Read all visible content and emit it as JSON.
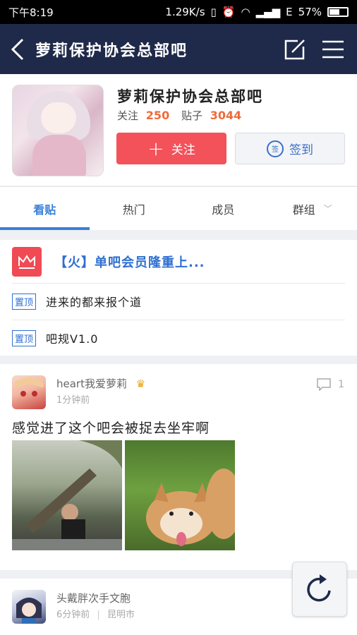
{
  "status_bar": {
    "time": "下午8:19",
    "speed": "1.29K/s",
    "network": "E",
    "battery": "57%"
  },
  "nav": {
    "title": "萝莉保护协会总部吧"
  },
  "forum": {
    "name": "萝莉保护协会总部吧",
    "follow_label": "关注",
    "follow_count": "250",
    "posts_label": "贴子",
    "posts_count": "3044",
    "follow_button": "关注",
    "sign_button": "签到",
    "sign_badge": "签"
  },
  "tabs": [
    {
      "label": "看贴"
    },
    {
      "label": "热门"
    },
    {
      "label": "成员"
    },
    {
      "label": "群组"
    }
  ],
  "pinned": {
    "headline": "【火】单吧会员隆重上...",
    "tag": "置顶",
    "items": [
      {
        "text": "进来的都来报个道"
      },
      {
        "text": "吧规V1.0"
      }
    ]
  },
  "posts": [
    {
      "user": "heart我爱萝莉",
      "time": "1分钟前",
      "comments": "1",
      "content": "感觉进了这个吧会被捉去坐牢啊"
    },
    {
      "user": "头戴胖次手文胞",
      "time": "6分钟前",
      "location": "昆明市"
    }
  ],
  "colors": {
    "navbar": "#1f2a4a",
    "accent_red": "#f3525a",
    "accent_blue": "#3a7fd9",
    "count_orange": "#f06a3a"
  }
}
